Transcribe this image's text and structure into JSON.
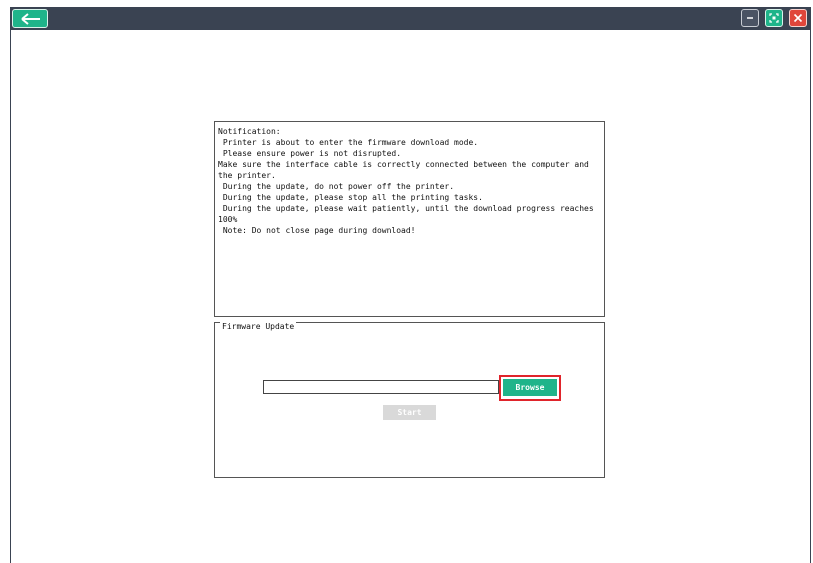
{
  "titlebar": {
    "back_icon": "arrow-left-icon",
    "minimize_icon": "minimize-icon",
    "maximize_icon": "fullscreen-icon",
    "close_icon": "close-icon"
  },
  "notification": {
    "lines": [
      "Notification:",
      " Printer is about to enter the firmware download mode.",
      " Please ensure power is not disrupted.",
      "Make sure the interface cable is correctly connected between the computer and the printer.",
      " During the update, do not power off the printer.",
      " During the update, please stop all the printing tasks.",
      " During the update, please wait patiently, until the download progress reaches 100%",
      " Note: Do not close page during download!"
    ]
  },
  "firmware": {
    "group_title": "Firmware Update",
    "file_path_value": "",
    "browse_label": "Browse",
    "start_label": "Start"
  },
  "colors": {
    "accent": "#1fb48a",
    "titlebar": "#3a4352",
    "close": "#e0463b",
    "highlight": "#e0242b",
    "disabled": "#d9d9d9"
  }
}
